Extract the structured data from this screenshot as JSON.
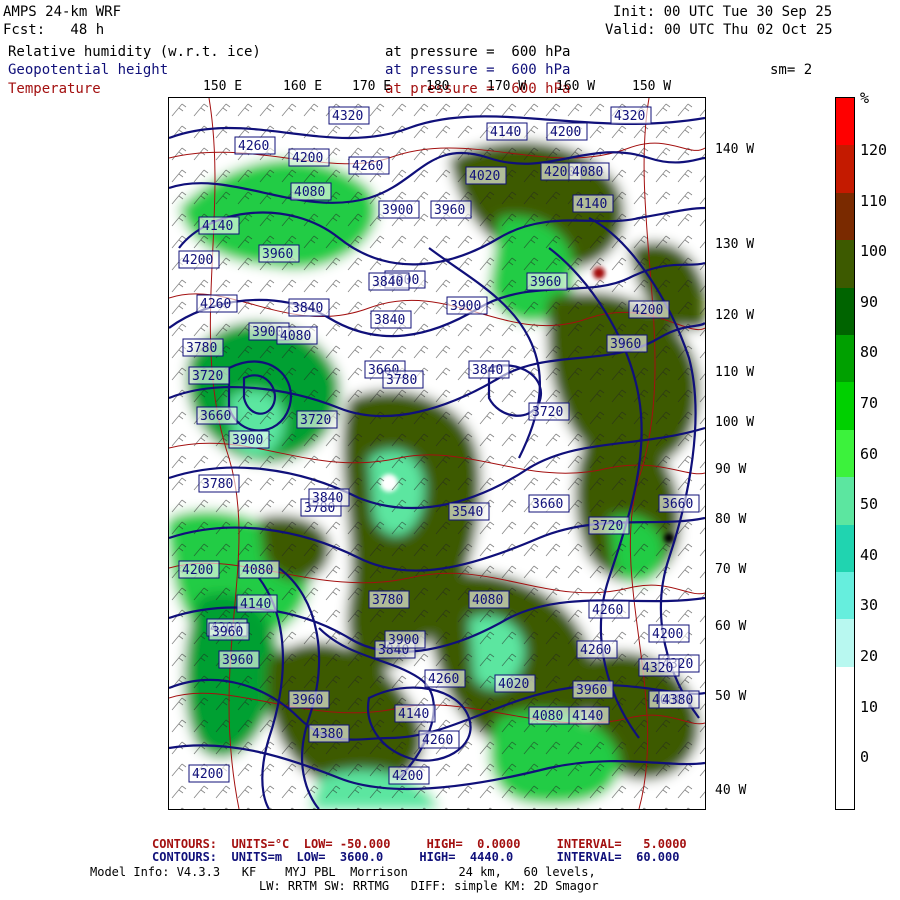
{
  "header": {
    "model": "AMPS 24-km WRF",
    "fcst": "Fcst:   48 h",
    "init": "Init: 00 UTC Tue 30 Sep 25",
    "valid": "Valid: 00 UTC Thu 02 Oct 25",
    "fields": [
      {
        "name": "Relative humidity (w.r.t. ice)",
        "level": "at pressure =  600 hPa",
        "color": "#000000"
      },
      {
        "name": "Geopotential height",
        "level": "at pressure =  600 hPa",
        "color": "#10107a"
      },
      {
        "name": "Temperature",
        "level": "at pressure =  600 hPa",
        "color": "#a31010"
      }
    ],
    "sm": "sm= 2"
  },
  "lon_labels": [
    "150 E",
    "160 E",
    "170 E",
    "180",
    "170 W",
    "160 W",
    "150 W"
  ],
  "lat_labels": [
    "140 W",
    "130 W",
    "120 W",
    "110 W",
    "100 W",
    "90 W",
    "80 W",
    "70 W",
    "60 W",
    "50 W",
    "40 W"
  ],
  "height_labels": [
    "4320",
    "4140",
    "4200",
    "4320",
    "4260",
    "4200",
    "4260",
    "4200",
    "4020",
    "4080",
    "4080",
    "3900",
    "3960",
    "4140",
    "4140",
    "4200",
    "3960",
    "3900",
    "4260",
    "3840",
    "3840",
    "3900",
    "3960",
    "4200",
    "3900",
    "4080",
    "3780",
    "3840",
    "3960",
    "3720",
    "3660",
    "3720",
    "3660",
    "3840",
    "3720",
    "3780",
    "3900",
    "3780",
    "3540",
    "3660",
    "3660",
    "3780",
    "3720",
    "4200",
    "4080",
    "3840",
    "3780",
    "3840",
    "4140",
    "4200",
    "3960",
    "3900",
    "4080",
    "4260",
    "4200",
    "4320",
    "4260",
    "4020",
    "3960",
    "3960",
    "4140",
    "4260",
    "3960",
    "4080",
    "4140",
    "4200",
    "4380",
    "4260",
    "4080",
    "4200",
    "4320",
    "4380"
  ],
  "colorbar": {
    "unit": "%",
    "ticks": [
      "120",
      "110",
      "100",
      "90",
      "80",
      "70",
      "60",
      "50",
      "40",
      "30",
      "20",
      "10",
      "0"
    ],
    "bands": [
      "#ff0000",
      "#c41a00",
      "#7a2a00",
      "#3d5a00",
      "#006400",
      "#00a000",
      "#00d000",
      "#3cf23c",
      "#5ce6a0",
      "#20d4b0",
      "#66eedd",
      "#b8f8f0",
      "#ffffff",
      "#ffffff",
      "#ffffff"
    ]
  },
  "footer": {
    "line1": {
      "label": "CONTOURS:",
      "units": "UNITS=°C",
      "low": "LOW= -50.000",
      "high": "HIGH=  0.0000",
      "interval": "INTERVAL=   5.0000",
      "color": "#a31010"
    },
    "line2": {
      "label": "CONTOURS:",
      "units": "UNITS=m",
      "low": "LOW=  3600.0",
      "high": "HIGH=  4440.0",
      "interval": "INTERVAL=  60.000",
      "color": "#10107a"
    },
    "line3": "Model Info: V4.3.3   KF    MYJ PBL  Morrison       24 km,   60 levels,",
    "line4": "LW: RRTM SW: RRTMG   DIFF: simple KM: 2D Smagor"
  }
}
